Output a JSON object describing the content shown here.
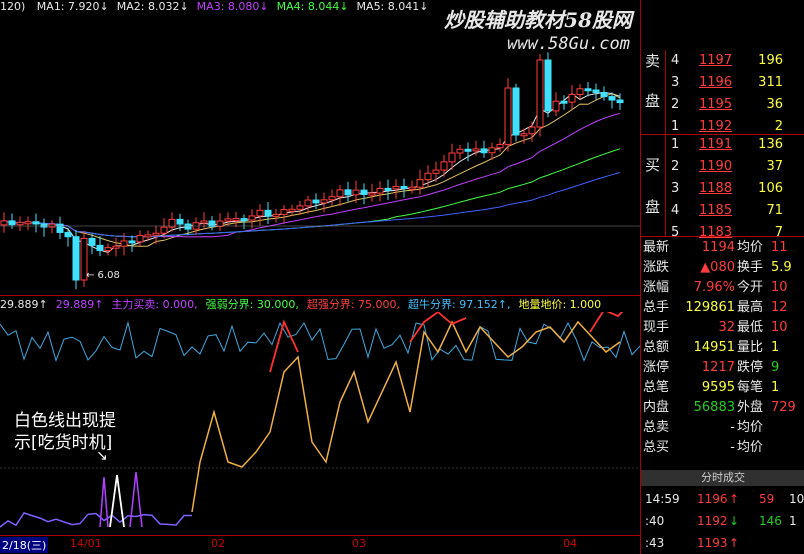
{
  "ma_bar": {
    "prefix": "120)",
    "items": [
      {
        "label": "MA1: 7.920↓",
        "color": "#e8e8e8"
      },
      {
        "label": "MA2: 8.032↓",
        "color": "#e8e8e8"
      },
      {
        "label": "MA3: 8.080↓",
        "color": "#c040ff"
      },
      {
        "label": "MA4: 8.044↓",
        "color": "#40ff40"
      },
      {
        "label": "MA5: 8.041↓",
        "color": "#e8e8e8"
      }
    ]
  },
  "indicator_bar": {
    "items": [
      {
        "label": "29.889↑",
        "color": "#e8e8e8"
      },
      {
        "label": "29.889↑",
        "color": "#c040ff"
      },
      {
        "label": "主力买卖: 0.000,",
        "color": "#c040ff"
      },
      {
        "label": "强弱分界: 30.000,",
        "color": "#40ff40"
      },
      {
        "label": "超强分界: 75.000,",
        "color": "#ff4040"
      },
      {
        "label": "超牛分界: 97.152↑,",
        "color": "#40c0ff"
      },
      {
        "label": "地量地价: 1.000",
        "color": "#ffff40"
      }
    ]
  },
  "watermark": {
    "title": "炒股辅助教材58股网",
    "url": "www.58Gu.com"
  },
  "annotation": {
    "line1": "白色线出现提",
    "line2": "示[吃货时机]"
  },
  "price_low_label": "6.08",
  "date_axis": {
    "period": "2/18(三)",
    "labels": [
      {
        "text": "14/01",
        "pos": 0.11
      },
      {
        "text": "02",
        "pos": 0.33
      },
      {
        "text": "03",
        "pos": 0.55
      },
      {
        "text": "04",
        "pos": 0.88
      }
    ]
  },
  "order_book": {
    "sell_label_top": "卖",
    "sell_label_bottom": "盘",
    "buy_label_top": "买",
    "buy_label_bottom": "盘",
    "sells": [
      {
        "level": "4",
        "price": "1197",
        "vol": "196"
      },
      {
        "level": "3",
        "price": "1196",
        "vol": "311"
      },
      {
        "level": "2",
        "price": "1195",
        "vol": "36"
      },
      {
        "level": "1",
        "price": "1192",
        "vol": "2"
      }
    ],
    "buys": [
      {
        "level": "1",
        "price": "1191",
        "vol": "136"
      },
      {
        "level": "2",
        "price": "1190",
        "vol": "37"
      },
      {
        "level": "3",
        "price": "1188",
        "vol": "106"
      },
      {
        "level": "4",
        "price": "1185",
        "vol": "71"
      },
      {
        "level": "5",
        "price": "1183",
        "vol": "7"
      }
    ]
  },
  "stats": [
    {
      "l1": "最新",
      "v1": "1194",
      "c1": "red",
      "l2": "均价",
      "v2": "11",
      "c2": "red"
    },
    {
      "l1": "涨跌",
      "v1": "▲080",
      "c1": "red",
      "l2": "换手",
      "v2": "5.9",
      "c2": "yellow"
    },
    {
      "l1": "涨幅",
      "v1": "7.96%",
      "c1": "red",
      "l2": "今开",
      "v2": "10",
      "c2": "red"
    },
    {
      "l1": "总手",
      "v1": "129861",
      "c1": "yellow",
      "l2": "最高",
      "v2": "12",
      "c2": "red"
    },
    {
      "l1": "现手",
      "v1": "32",
      "c1": "red",
      "l2": "最低",
      "v2": "10",
      "c2": "red"
    },
    {
      "l1": "总额",
      "v1": "14951",
      "c1": "yellow",
      "l2": "量比",
      "v2": "1",
      "c2": "yellow"
    },
    {
      "l1": "涨停",
      "v1": "1217",
      "c1": "red",
      "l2": "跌停",
      "v2": "9",
      "c2": "green"
    },
    {
      "l1": "总笔",
      "v1": "9595",
      "c1": "yellow",
      "l2": "每笔",
      "v2": "1",
      "c2": "yellow"
    },
    {
      "l1": "内盘",
      "v1": "56883",
      "c1": "green",
      "l2": "外盘",
      "v2": "729",
      "c2": "red"
    },
    {
      "l1": "总卖",
      "v1": "-",
      "c1": "white",
      "l2": "均价",
      "v2": "",
      "c2": "white"
    },
    {
      "l1": "总买",
      "v1": "-",
      "c1": "white",
      "l2": "均价",
      "v2": "",
      "c2": "white"
    }
  ],
  "ticks_header": "分时成交",
  "ticks": [
    {
      "time": "14:59",
      "price": "1196",
      "dir": "↑",
      "vol": "59",
      "extra": "10"
    },
    {
      "time": ":40",
      "price": "1192",
      "dir": "↓",
      "vol": "146",
      "extra": "1"
    },
    {
      "time": ":43",
      "price": "1193",
      "dir": "↑",
      "vol": "",
      "extra": ""
    }
  ],
  "colors": {
    "up": "#ff3c3c",
    "down": "#20d020",
    "accent": "#a00000"
  }
}
